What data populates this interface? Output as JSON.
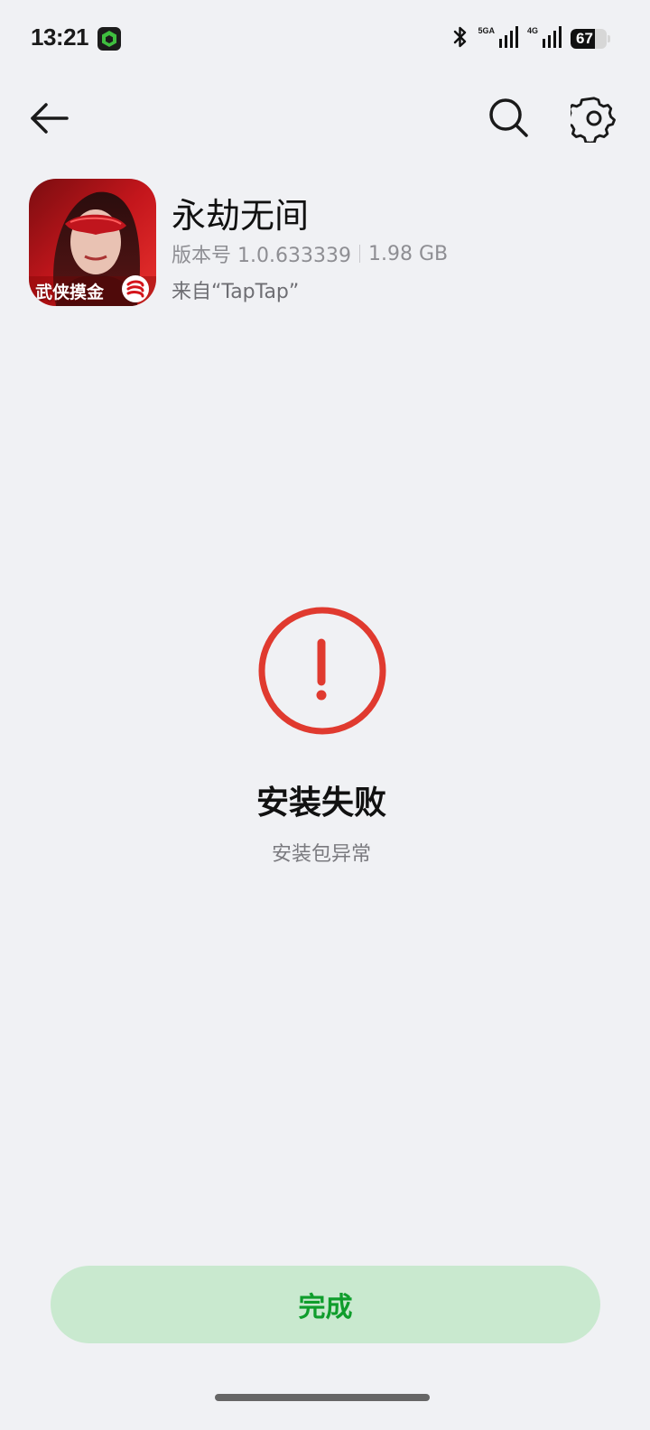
{
  "status_bar": {
    "time": "13:21",
    "notification_icon": "vpn-shield-icon",
    "bluetooth_icon": "bluetooth-icon",
    "sim1_label": "5GA",
    "sim2_label": "4G",
    "battery_level": "67",
    "battery_fraction": 0.67
  },
  "nav": {
    "back_icon": "arrow-left-icon",
    "search_icon": "search-icon",
    "settings_icon": "gear-icon"
  },
  "app": {
    "name": "永劫无间",
    "version": "版本号 1.0.633339",
    "size": "1.98 GB",
    "source": "来自“TapTap”",
    "icon_caption": "武侠摸金",
    "colors": {
      "icon_red": "#b3121a"
    }
  },
  "result": {
    "icon": "exclamation-circle-icon",
    "title": "安装失败",
    "subtitle": "安装包异常",
    "color": "#e03a2f"
  },
  "actions": {
    "done_label": "完成",
    "done_bg": "#c9e9cf",
    "done_text_color": "#0f9d2c"
  }
}
